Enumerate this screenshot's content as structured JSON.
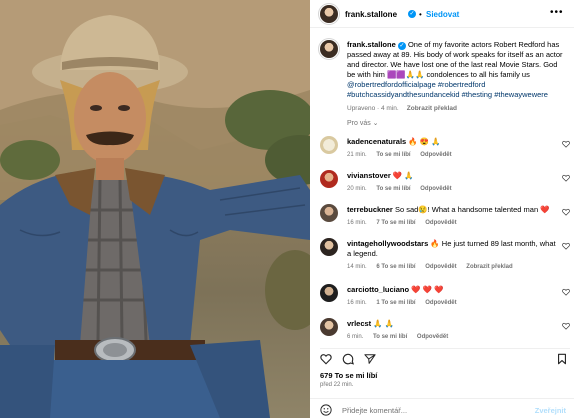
{
  "photo": {
    "alt_icon": "robert-redford-photo"
  },
  "post": {
    "username": "frank.stallone",
    "follow_label": "Siedovat",
    "more_label": "•••",
    "caption_user": "frank.stallone",
    "caption_text": "One of my favorite actors Robert Redford has passed away at 89. His body of work speaks for itself as an actor and director. We have lost one of the last real Movie Stars. God be with him 🟪🟪🙏🙏 condolences to all his family us",
    "caption_tags": "@robertredfordofficialpage #robertredford #butchcassidyandthesundancekid #thesting #thewaywewere",
    "caption_meta_edited": "Upraveno · 4 min.",
    "caption_meta_translate": "Zobrazit překlad",
    "section_label": "Pro vás ⌄"
  },
  "comments": [
    {
      "user": "kadencenaturals",
      "text": "🔥 😍 🙏",
      "time": "21 min.",
      "likes": "To se mi líbí",
      "reply": "Odpovědět"
    },
    {
      "user": "vivianstover",
      "text": "❤️ 🙏",
      "time": "20 min.",
      "likes": "To se mi líbí",
      "reply": "Odpovědět"
    },
    {
      "user": "terrebuckner",
      "text": "So sad😢! What a handsome talented man ❤️",
      "time": "16 min.",
      "likes": "7 To se mi líbí",
      "reply": "Odpovědět"
    },
    {
      "user": "vintagehollywoodstars",
      "text": "🔥 He just turned 89 last month, what a legend.",
      "time": "14 min.",
      "likes": "6 To se mi líbí",
      "reply": "Odpovědět",
      "translate": "Zobrazit překlad"
    },
    {
      "user": "carciotto_luciano",
      "text": "❤️ ❤️ ❤️",
      "time": "16 min.",
      "likes": "1 To se mi líbí",
      "reply": "Odpovědět"
    },
    {
      "user": "vrlecst",
      "text": "🙏 🙏",
      "time": "6 min.",
      "likes": "To se mi líbí",
      "reply": "Odpovědět"
    }
  ],
  "footer": {
    "likes": "679 To se mi líbí",
    "time": "před 22 min.",
    "composer_placeholder": "Přidejte komentář...",
    "post_label": "Zveřejnit"
  }
}
